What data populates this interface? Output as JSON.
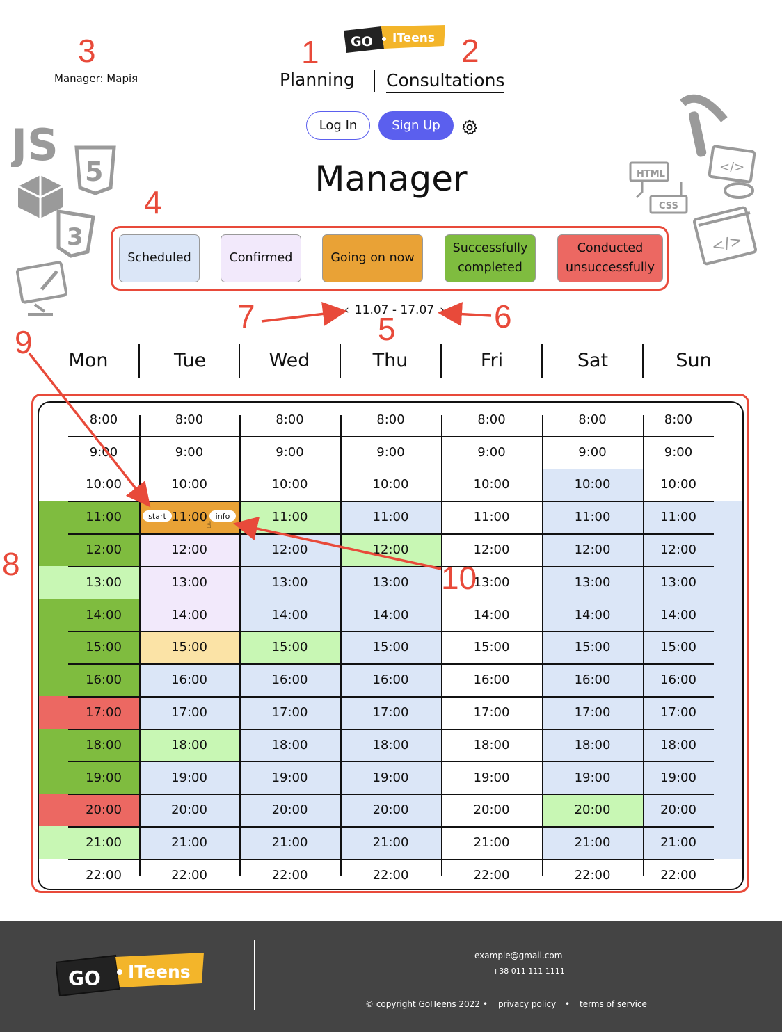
{
  "header": {
    "manager_label": "Manager: Марія",
    "nav": {
      "planning": "Planning",
      "consultations": "Consultations"
    },
    "login": "Log In",
    "signup": "Sign Up",
    "logo": {
      "part1": "GO",
      "part2": "ITeens"
    }
  },
  "page_title": "Manager",
  "legend": [
    {
      "label": "Scheduled",
      "color": "#dbe6f7"
    },
    {
      "label": "Confirmed",
      "color": "#f2e9fb"
    },
    {
      "label": "Going on now",
      "color": "#e9a236"
    },
    {
      "label": "Successfully completed",
      "color": "#7fbc3f"
    },
    {
      "label": "Conducted unsuccessfully",
      "color": "#ec6862"
    }
  ],
  "week": {
    "prev": "‹",
    "range": "11.07 - 17.07",
    "next": "›"
  },
  "days": [
    "Mon",
    "Tue",
    "Wed",
    "Thu",
    "Fri",
    "Sat",
    "Sun"
  ],
  "times": [
    "8:00",
    "9:00",
    "10:00",
    "11:00",
    "12:00",
    "13:00",
    "14:00",
    "15:00",
    "16:00",
    "17:00",
    "18:00",
    "19:00",
    "20:00",
    "21:00",
    "22:00"
  ],
  "slot_actions": {
    "start": "start",
    "info": "info"
  },
  "colors": {
    "scheduled": "#dbe6f7",
    "confirmed": "#f2e9fb",
    "going": "#e9a236",
    "success": "#7fbc3f",
    "fail": "#ec6862",
    "light_green": "#c8f7b4",
    "yellow": "#fbe3a6",
    "accent": "#5b5fee",
    "annotation": "#e84a3a"
  },
  "annotations": [
    "1",
    "2",
    "3",
    "4",
    "5",
    "6",
    "7",
    "8",
    "9",
    "10"
  ],
  "footer": {
    "email": "example@gmail.com",
    "phone": "+38 011 111 1111",
    "copyright": "© copyright GoITeens 2022",
    "privacy": "privacy policy",
    "terms": "terms of service",
    "bullet": "•"
  }
}
